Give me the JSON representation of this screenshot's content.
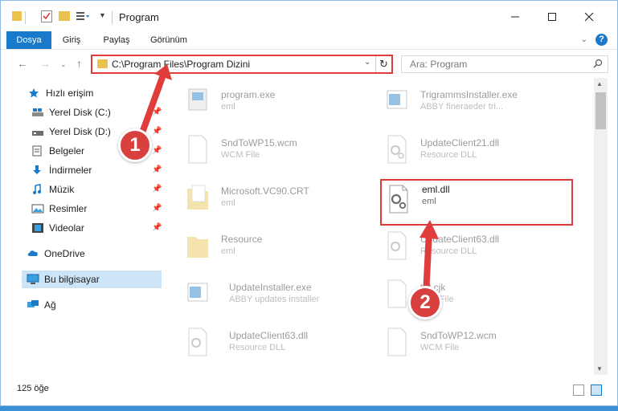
{
  "window": {
    "title": "Program"
  },
  "ribbon": {
    "tabs": [
      "Dosya",
      "Giriş",
      "Paylaş",
      "Görünüm"
    ]
  },
  "address": {
    "path": "C:\\Program Files\\Program Dizini"
  },
  "search": {
    "placeholder": "Ara: Program"
  },
  "sidebar": {
    "items": [
      {
        "label": "Hızlı erişim"
      },
      {
        "label": "Yerel Disk (C:)"
      },
      {
        "label": "Yerel Disk (D:)"
      },
      {
        "label": "Belgeler"
      },
      {
        "label": "İndirmeler"
      },
      {
        "label": "Müzik"
      },
      {
        "label": "Resimler"
      },
      {
        "label": "Videolar"
      },
      {
        "label": "OneDrive"
      },
      {
        "label": "Bu bilgisayar"
      },
      {
        "label": "Ağ"
      }
    ]
  },
  "files": [
    {
      "name": "program.exe",
      "desc": "eml"
    },
    {
      "name": "TrigrammsInstaller.exe",
      "desc": "ABBY fineraeder tri..."
    },
    {
      "name": "SndToWP15.wcm",
      "desc": "WCM File"
    },
    {
      "name": "UpdateClient21.dll",
      "desc": "Resource DLL"
    },
    {
      "name": "Microsoft.VC90.CRT",
      "desc": "eml"
    },
    {
      "name": "eml.dll",
      "desc": "eml"
    },
    {
      "name": "Resource",
      "desc": "eml"
    },
    {
      "name": "UpdateClient63.dll",
      "desc": "Resource DLL"
    },
    {
      "name": "UpdateInstaller.exe",
      "desc": "ABBY updates installer"
    },
    {
      "name": "ttd.cjk",
      "desc": "CJK File"
    },
    {
      "name": "UpdateClient63.dll",
      "desc": "Resource DLL"
    },
    {
      "name": "SndToWP12.wcm",
      "desc": "WCM File"
    }
  ],
  "status": {
    "count": "125 öğe"
  },
  "callouts": {
    "one": "1",
    "two": "2"
  },
  "colors": {
    "accent": "#1979ca",
    "highlight": "#e03c3c"
  }
}
